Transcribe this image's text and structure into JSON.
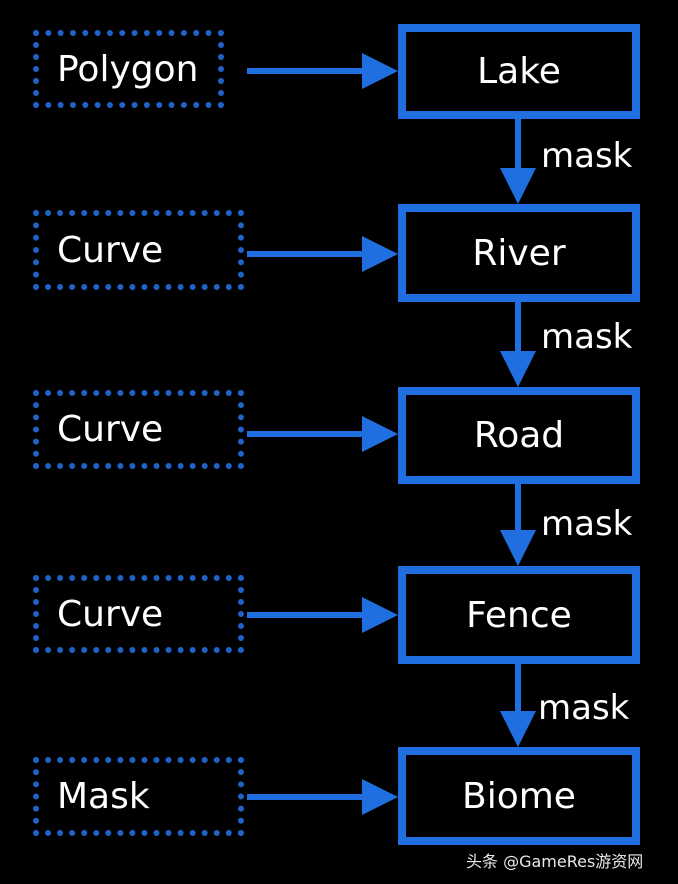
{
  "colors": {
    "accent": "#1f6fe0",
    "background": "#000000",
    "text": "#ffffff"
  },
  "rows": [
    {
      "source": "Polygon",
      "target": "Lake"
    },
    {
      "source": "Curve",
      "target": "River"
    },
    {
      "source": "Curve",
      "target": "Road"
    },
    {
      "source": "Curve",
      "target": "Fence"
    },
    {
      "source": "Mask",
      "target": "Biome"
    }
  ],
  "edge_labels": [
    "mask",
    "mask",
    "mask",
    "mask"
  ],
  "watermark": "头条 @GameRes游资网"
}
